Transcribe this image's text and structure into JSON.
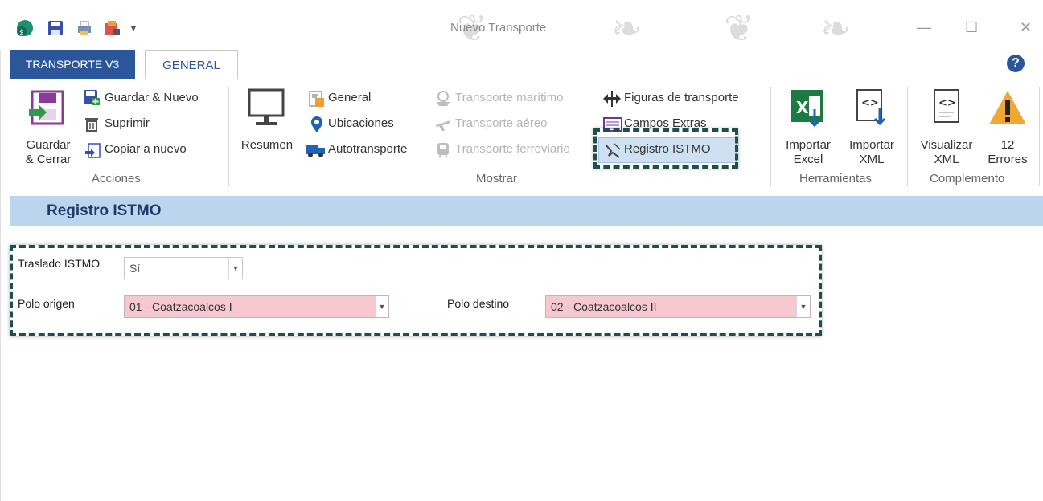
{
  "window": {
    "title": "Nuevo Transporte"
  },
  "tabs": [
    {
      "label": "TRANSPORTE V3"
    },
    {
      "label": "GENERAL"
    }
  ],
  "ribbon": {
    "acciones": {
      "label": "Acciones",
      "guardar_cerrar": "Guardar\n& Cerrar",
      "guardar_nuevo": "Guardar & Nuevo",
      "suprimir": "Suprimir",
      "copiar": "Copiar a nuevo"
    },
    "mostrar": {
      "label": "Mostrar",
      "resumen": "Resumen",
      "general": "General",
      "ubicaciones": "Ubicaciones",
      "autotransporte": "Autotransporte",
      "maritimo": "Transporte marítimo",
      "aereo": "Transporte aéreo",
      "ferroviario": "Transporte ferroviario",
      "figuras": "Figuras de transporte",
      "campos": "Campos Extras",
      "istmo": "Registro ISTMO"
    },
    "herramientas": {
      "label": "Herramientas",
      "importar_excel": "Importar\nExcel",
      "importar_xml": "Importar\nXML"
    },
    "complemento": {
      "label": "Complemento",
      "visualizar_xml": "Visualizar\nXML",
      "errores": "12\nErrores"
    }
  },
  "section": {
    "title": "Registro ISTMO"
  },
  "form": {
    "traslado_label": "Traslado ISTMO",
    "traslado_value": "Sí",
    "polo_origen_label": "Polo origen",
    "polo_origen_value": "01 - Coatzacoalcos I",
    "polo_destino_label": "Polo destino",
    "polo_destino_value": "02 - Coatzacoalcos II"
  },
  "colors": {
    "accent": "#2b579a",
    "section_bg": "#bcd5ee",
    "required_bg": "#f7c8cf",
    "highlight_border": "#1e4f4a"
  }
}
